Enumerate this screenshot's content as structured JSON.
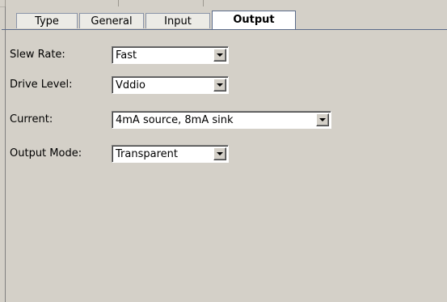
{
  "tabs": [
    {
      "label": "Type",
      "active": false
    },
    {
      "label": "General",
      "active": false
    },
    {
      "label": "Input",
      "active": false
    },
    {
      "label": "Output",
      "active": true
    }
  ],
  "fields": {
    "slew_rate": {
      "label": "Slew Rate:",
      "value": "Fast"
    },
    "drive_level": {
      "label": "Drive Level:",
      "value": "Vddio"
    },
    "current": {
      "label": "Current:",
      "value": "4mA source, 8mA sink"
    },
    "output_mode": {
      "label": "Output Mode:",
      "value": "Transparent"
    }
  },
  "icons": {
    "dropdown": "chevron-down-icon"
  },
  "colors": {
    "panel": "#d4d0c8",
    "active_tab": "#ffffff",
    "tab_border": "#5b6b8a"
  }
}
